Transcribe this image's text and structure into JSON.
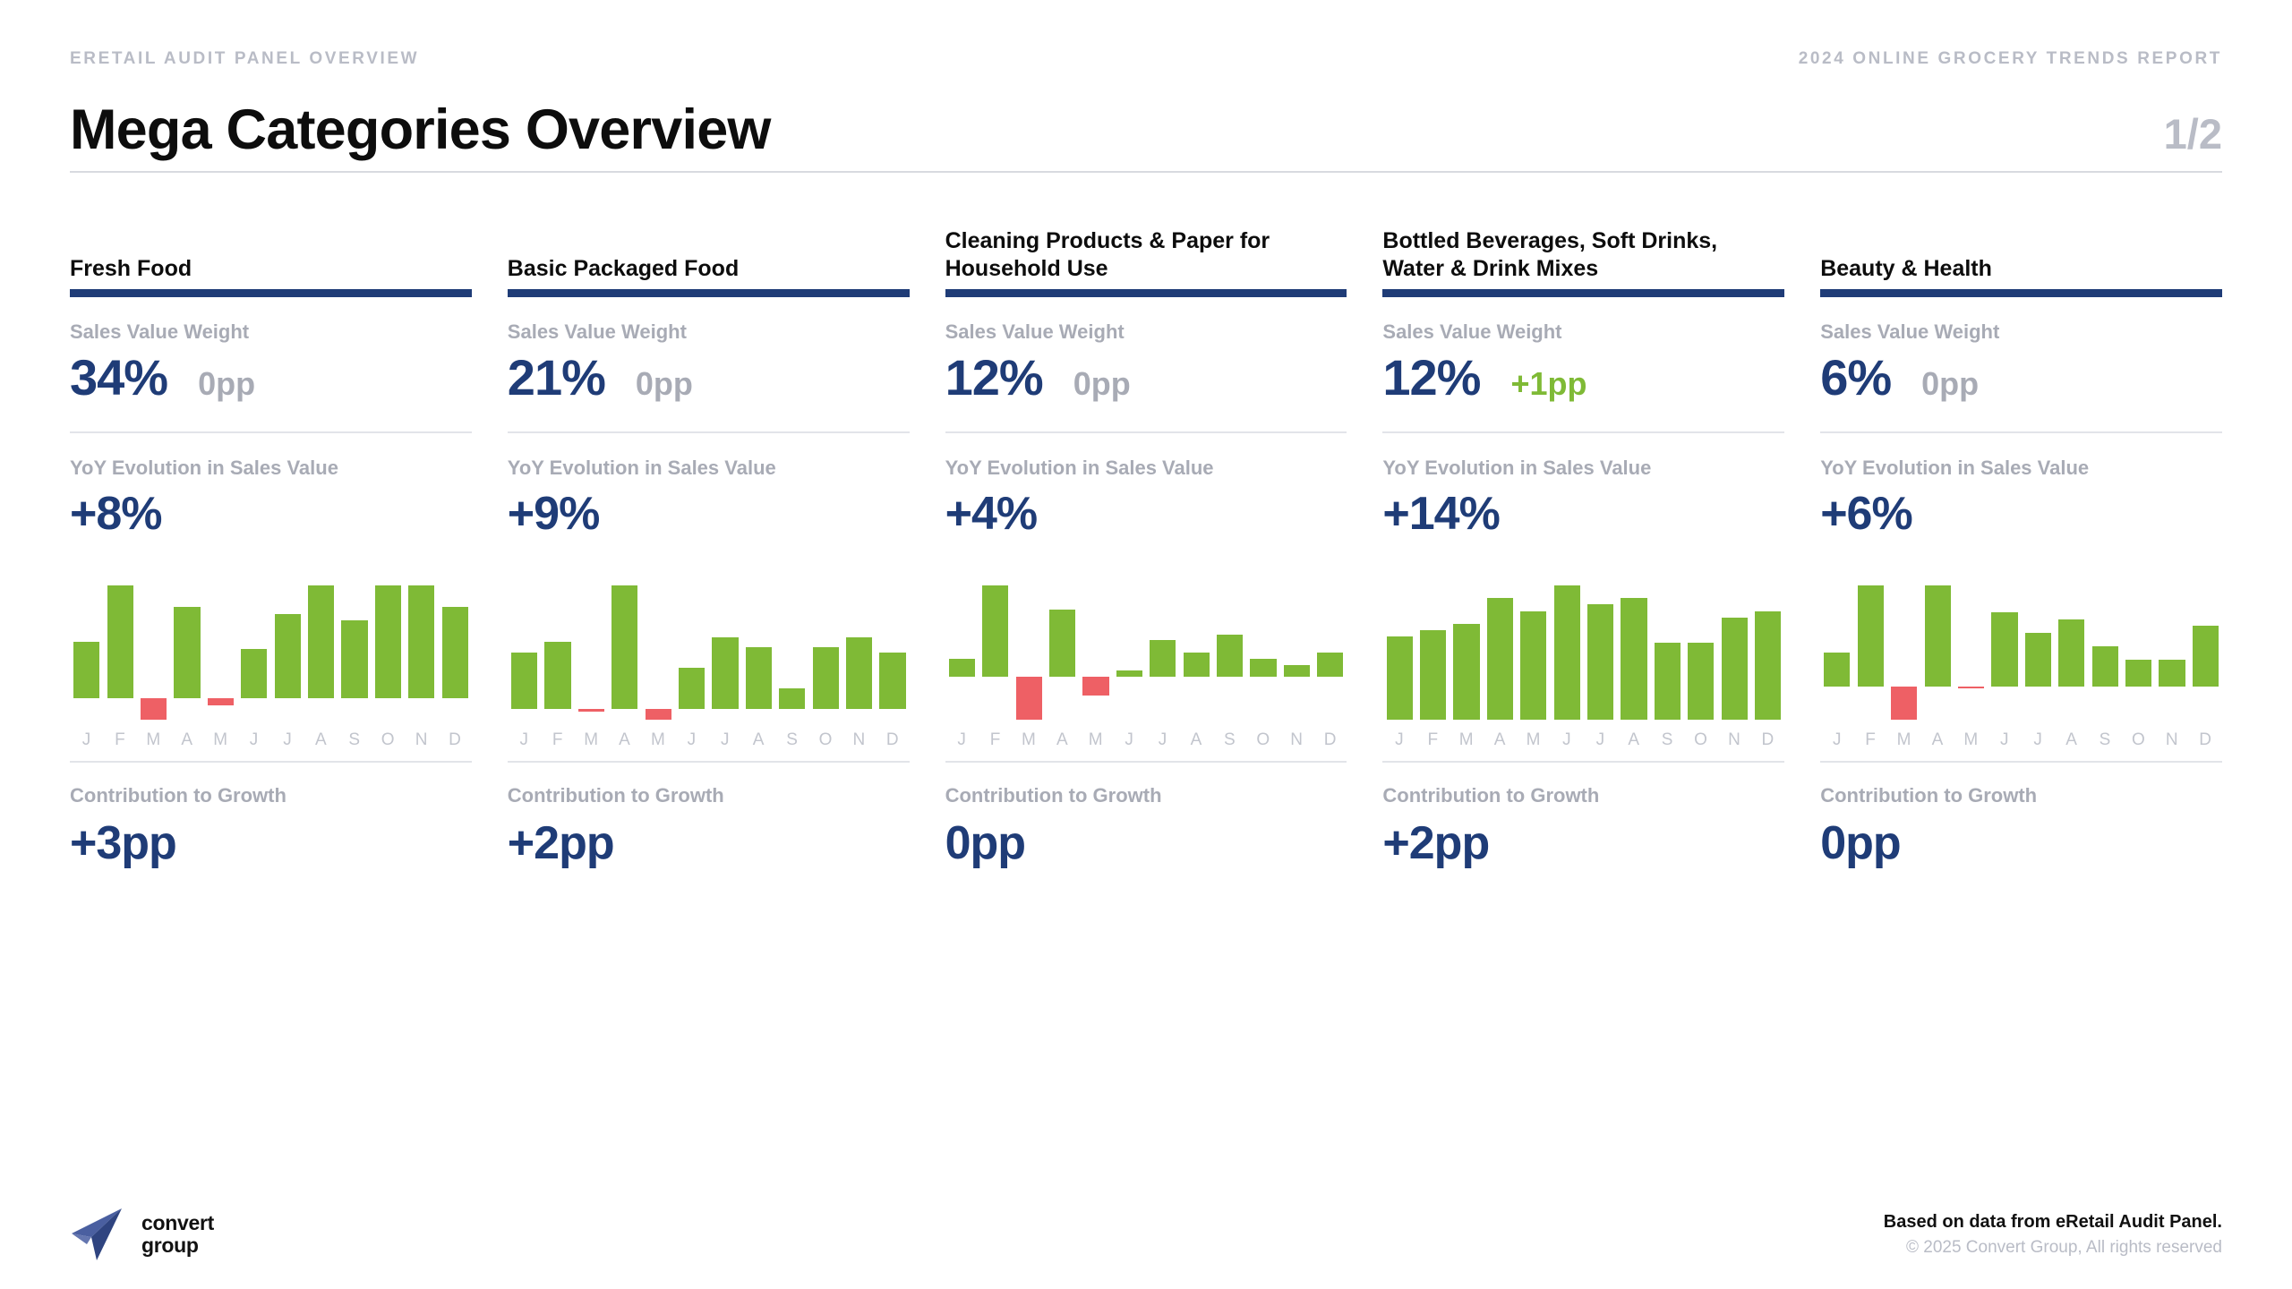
{
  "header": {
    "eyebrow_left": "ERETAIL AUDIT PANEL OVERVIEW",
    "eyebrow_right": "2024 ONLINE GROCERY TRENDS REPORT",
    "title": "Mega Categories Overview",
    "page_number": "1/2"
  },
  "labels": {
    "sales_value_weight": "Sales Value Weight",
    "yoy_evolution": "YoY Evolution in Sales Value",
    "contribution": "Contribution to Growth"
  },
  "colors": {
    "brand_blue": "#1f3c77",
    "positive_green": "#7fba36",
    "negative_red": "#ee6065",
    "muted_grey": "#a8abb5"
  },
  "months": [
    "J",
    "F",
    "M",
    "A",
    "M",
    "J",
    "J",
    "A",
    "S",
    "O",
    "N",
    "D"
  ],
  "cards": [
    {
      "title": "Fresh Food",
      "weight": "34%",
      "weight_delta": "0pp",
      "weight_delta_positive": false,
      "yoy": "+8%",
      "contribution": "+3pp"
    },
    {
      "title": "Basic Packaged Food",
      "weight": "21%",
      "weight_delta": "0pp",
      "weight_delta_positive": false,
      "yoy": "+9%",
      "contribution": "+2pp"
    },
    {
      "title": "Cleaning Products & Paper for Household Use",
      "weight": "12%",
      "weight_delta": "0pp",
      "weight_delta_positive": false,
      "yoy": "+4%",
      "contribution": "0pp"
    },
    {
      "title": "Bottled Beverages, Soft Drinks, Water & Drink Mixes",
      "weight": "12%",
      "weight_delta": "+1pp",
      "weight_delta_positive": true,
      "yoy": "+14%",
      "contribution": "+2pp"
    },
    {
      "title": "Beauty & Health",
      "weight": "6%",
      "weight_delta": "0pp",
      "weight_delta_positive": false,
      "yoy": "+6%",
      "contribution": "0pp"
    }
  ],
  "chart_data": [
    {
      "type": "bar",
      "title": "Fresh Food monthly YoY sales value change",
      "categories": [
        "J",
        "F",
        "M",
        "A",
        "M",
        "J",
        "J",
        "A",
        "S",
        "O",
        "N",
        "D"
      ],
      "values": [
        8,
        16,
        -3,
        13,
        -1,
        7,
        12,
        16,
        11,
        16,
        16,
        13
      ],
      "ylabel": "",
      "xlabel": "",
      "ylim": [
        -6,
        18
      ],
      "grid": false,
      "legend": "none"
    },
    {
      "type": "bar",
      "title": "Basic Packaged Food monthly YoY sales value change",
      "categories": [
        "J",
        "F",
        "M",
        "A",
        "M",
        "J",
        "J",
        "A",
        "S",
        "O",
        "N",
        "D"
      ],
      "values": [
        11,
        13,
        -0.4,
        24,
        -2,
        8,
        14,
        12,
        4,
        12,
        14,
        11
      ],
      "ylabel": "",
      "xlabel": "",
      "ylim": [
        -6,
        26
      ],
      "grid": false,
      "legend": "none"
    },
    {
      "type": "bar",
      "title": "Cleaning Products & Paper for Household Use monthly YoY sales value change",
      "categories": [
        "J",
        "F",
        "M",
        "A",
        "M",
        "J",
        "J",
        "A",
        "S",
        "O",
        "N",
        "D"
      ],
      "values": [
        3,
        15,
        -7,
        11,
        -3,
        1,
        6,
        4,
        7,
        3,
        2,
        4
      ],
      "ylabel": "",
      "xlabel": "",
      "ylim": [
        -9,
        17
      ],
      "grid": false,
      "legend": "none"
    },
    {
      "type": "bar",
      "title": "Bottled Beverages, Soft Drinks, Water & Drink Mixes monthly YoY sales value change",
      "categories": [
        "J",
        "F",
        "M",
        "A",
        "M",
        "J",
        "J",
        "A",
        "S",
        "O",
        "N",
        "D"
      ],
      "values": [
        13,
        14,
        15,
        19,
        17,
        21,
        18,
        19,
        12,
        12,
        16,
        17
      ],
      "ylabel": "",
      "xlabel": "",
      "ylim": [
        0,
        23
      ],
      "grid": false,
      "legend": "none"
    },
    {
      "type": "bar",
      "title": "Beauty & Health monthly YoY sales value change",
      "categories": [
        "J",
        "F",
        "M",
        "A",
        "M",
        "J",
        "J",
        "A",
        "S",
        "O",
        "N",
        "D"
      ],
      "values": [
        5,
        15,
        -5,
        15,
        -0.3,
        11,
        8,
        10,
        6,
        4,
        4,
        9
      ],
      "ylabel": "",
      "xlabel": "",
      "ylim": [
        -7,
        17
      ],
      "grid": false,
      "legend": "none"
    }
  ],
  "footer": {
    "logo_text": "convert\ngroup",
    "source": "Based on data from eRetail Audit Panel.",
    "copyright": "© 2025 Convert Group, All rights reserved"
  }
}
